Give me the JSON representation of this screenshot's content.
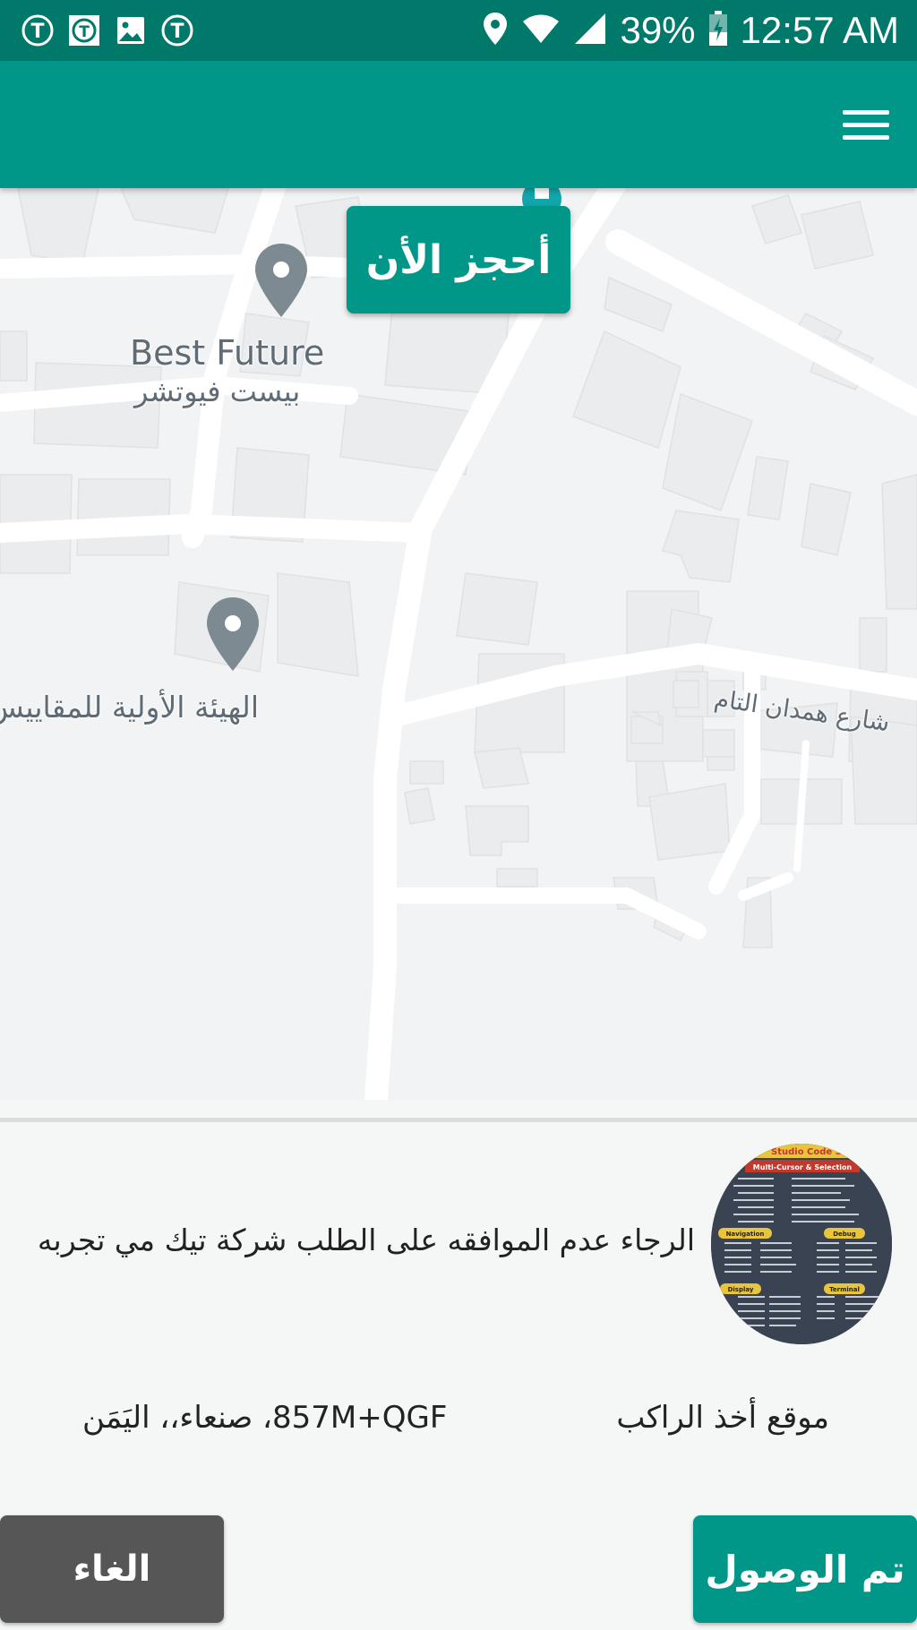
{
  "status_bar": {
    "battery": "39%",
    "time": "12:57 AM",
    "left_icons": [
      "t-circle-icon",
      "t-square-icon",
      "image-icon",
      "t-circle-icon"
    ],
    "right_icons": [
      "location-icon",
      "wifi-icon",
      "signal-icon",
      "battery-charging-icon"
    ]
  },
  "app_bar": {
    "menu_icon": "hamburger-menu-icon"
  },
  "map": {
    "book_now_label": "أحجز الأن",
    "places": [
      {
        "name_en": "Best Future",
        "name_ar": "بيست فيوتشر"
      },
      {
        "name_ar": "الهيئة الأولية للمقاييس"
      }
    ],
    "street": "شارع همدان التام"
  },
  "panel": {
    "notice": "الرجاء عدم الموافقه على الطلب شركة تيك مي تجربه",
    "pickup_label": "موقع أخذ الراكب",
    "pickup_address": "857M+QGF، صنعاء،، اليَمَن",
    "avatar_texts": [
      "Studio Code Sh",
      "Multi-Cursor & Selection",
      "Navigation",
      "Debug",
      "Display",
      "Terminal"
    ]
  },
  "buttons": {
    "cancel": "الغاء",
    "arrived": "تم الوصول"
  },
  "colors": {
    "status_bar": "#00796b",
    "app_bar": "#009688",
    "accent": "#009688",
    "cancel": "#565656"
  }
}
